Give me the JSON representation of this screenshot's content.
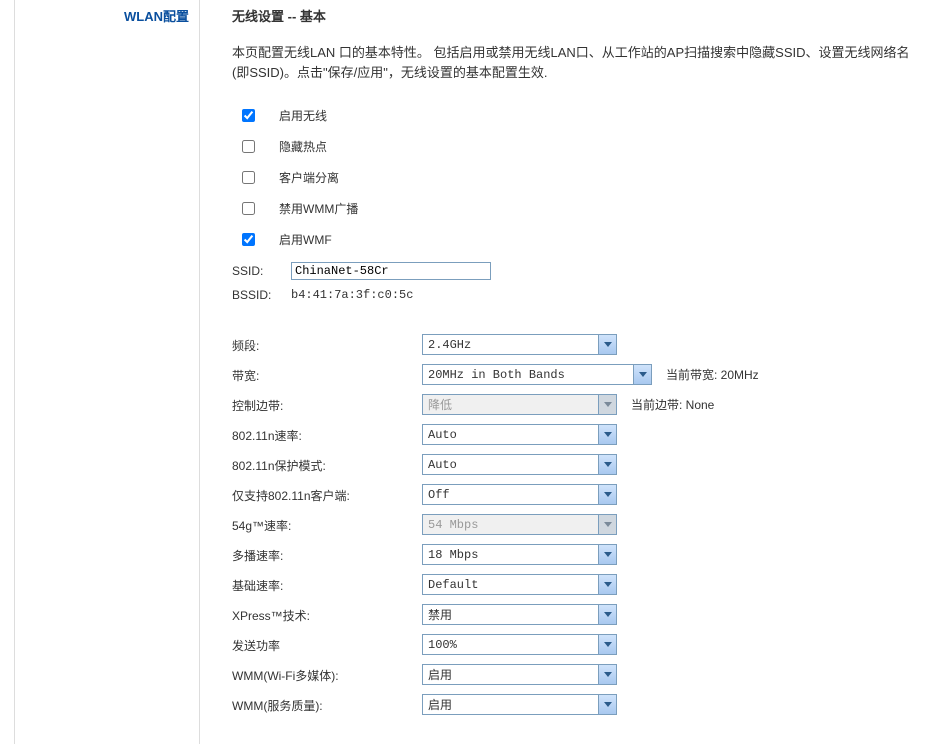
{
  "sidebar": {
    "items": [
      {
        "label": "WLAN配置"
      }
    ]
  },
  "page": {
    "title": "无线设置 -- 基本",
    "desc": "本页配置无线LAN 口的基本特性。 包括启用或禁用无线LAN口、从工作站的AP扫描搜索中隐藏SSID、设置无线网络名(即SSID)。点击\"保存/应用\"，无线设置的基本配置生效."
  },
  "checkboxes": {
    "enable_wifi": {
      "label": "启用无线",
      "checked": true
    },
    "hide_ap": {
      "label": "隐藏热点",
      "checked": false
    },
    "client_iso": {
      "label": "客户端分离",
      "checked": false
    },
    "disable_wmm_bc": {
      "label": "禁用WMM广播",
      "checked": false
    },
    "enable_wmf": {
      "label": "启用WMF",
      "checked": true
    }
  },
  "ssid": {
    "label": "SSID:",
    "value": "ChinaNet-58Cr"
  },
  "bssid": {
    "label": "BSSID:",
    "value": "b4:41:7a:3f:c0:5c"
  },
  "fields": {
    "band": {
      "label": "频段:",
      "value": "2.4GHz"
    },
    "bw": {
      "label": "带宽:",
      "value": "20MHz in Both Bands",
      "side": "当前带宽: 20MHz"
    },
    "sideband": {
      "label": "控制边带:",
      "value": "降低",
      "side": "当前边带: None",
      "disabled": true
    },
    "rate_n": {
      "label": "802.11n速率:",
      "value": "Auto"
    },
    "prot_n": {
      "label": "802.11n保护模式:",
      "value": "Auto"
    },
    "only_n": {
      "label": "仅支持802.11n客户端:",
      "value": "Off"
    },
    "rate_54g": {
      "label": "54g™速率:",
      "value": "54 Mbps",
      "disabled": true
    },
    "multicast": {
      "label": "多播速率:",
      "value": "18 Mbps"
    },
    "basic": {
      "label": "基础速率:",
      "value": "Default"
    },
    "xpress": {
      "label": "XPress™技术:",
      "value": "禁用"
    },
    "txpower": {
      "label": "发送功率",
      "value": "100%"
    },
    "wmm_media": {
      "label": "WMM(Wi-Fi多媒体):",
      "value": "启用"
    },
    "wmm_qos": {
      "label": "WMM(服务质量):",
      "value": "启用"
    }
  }
}
